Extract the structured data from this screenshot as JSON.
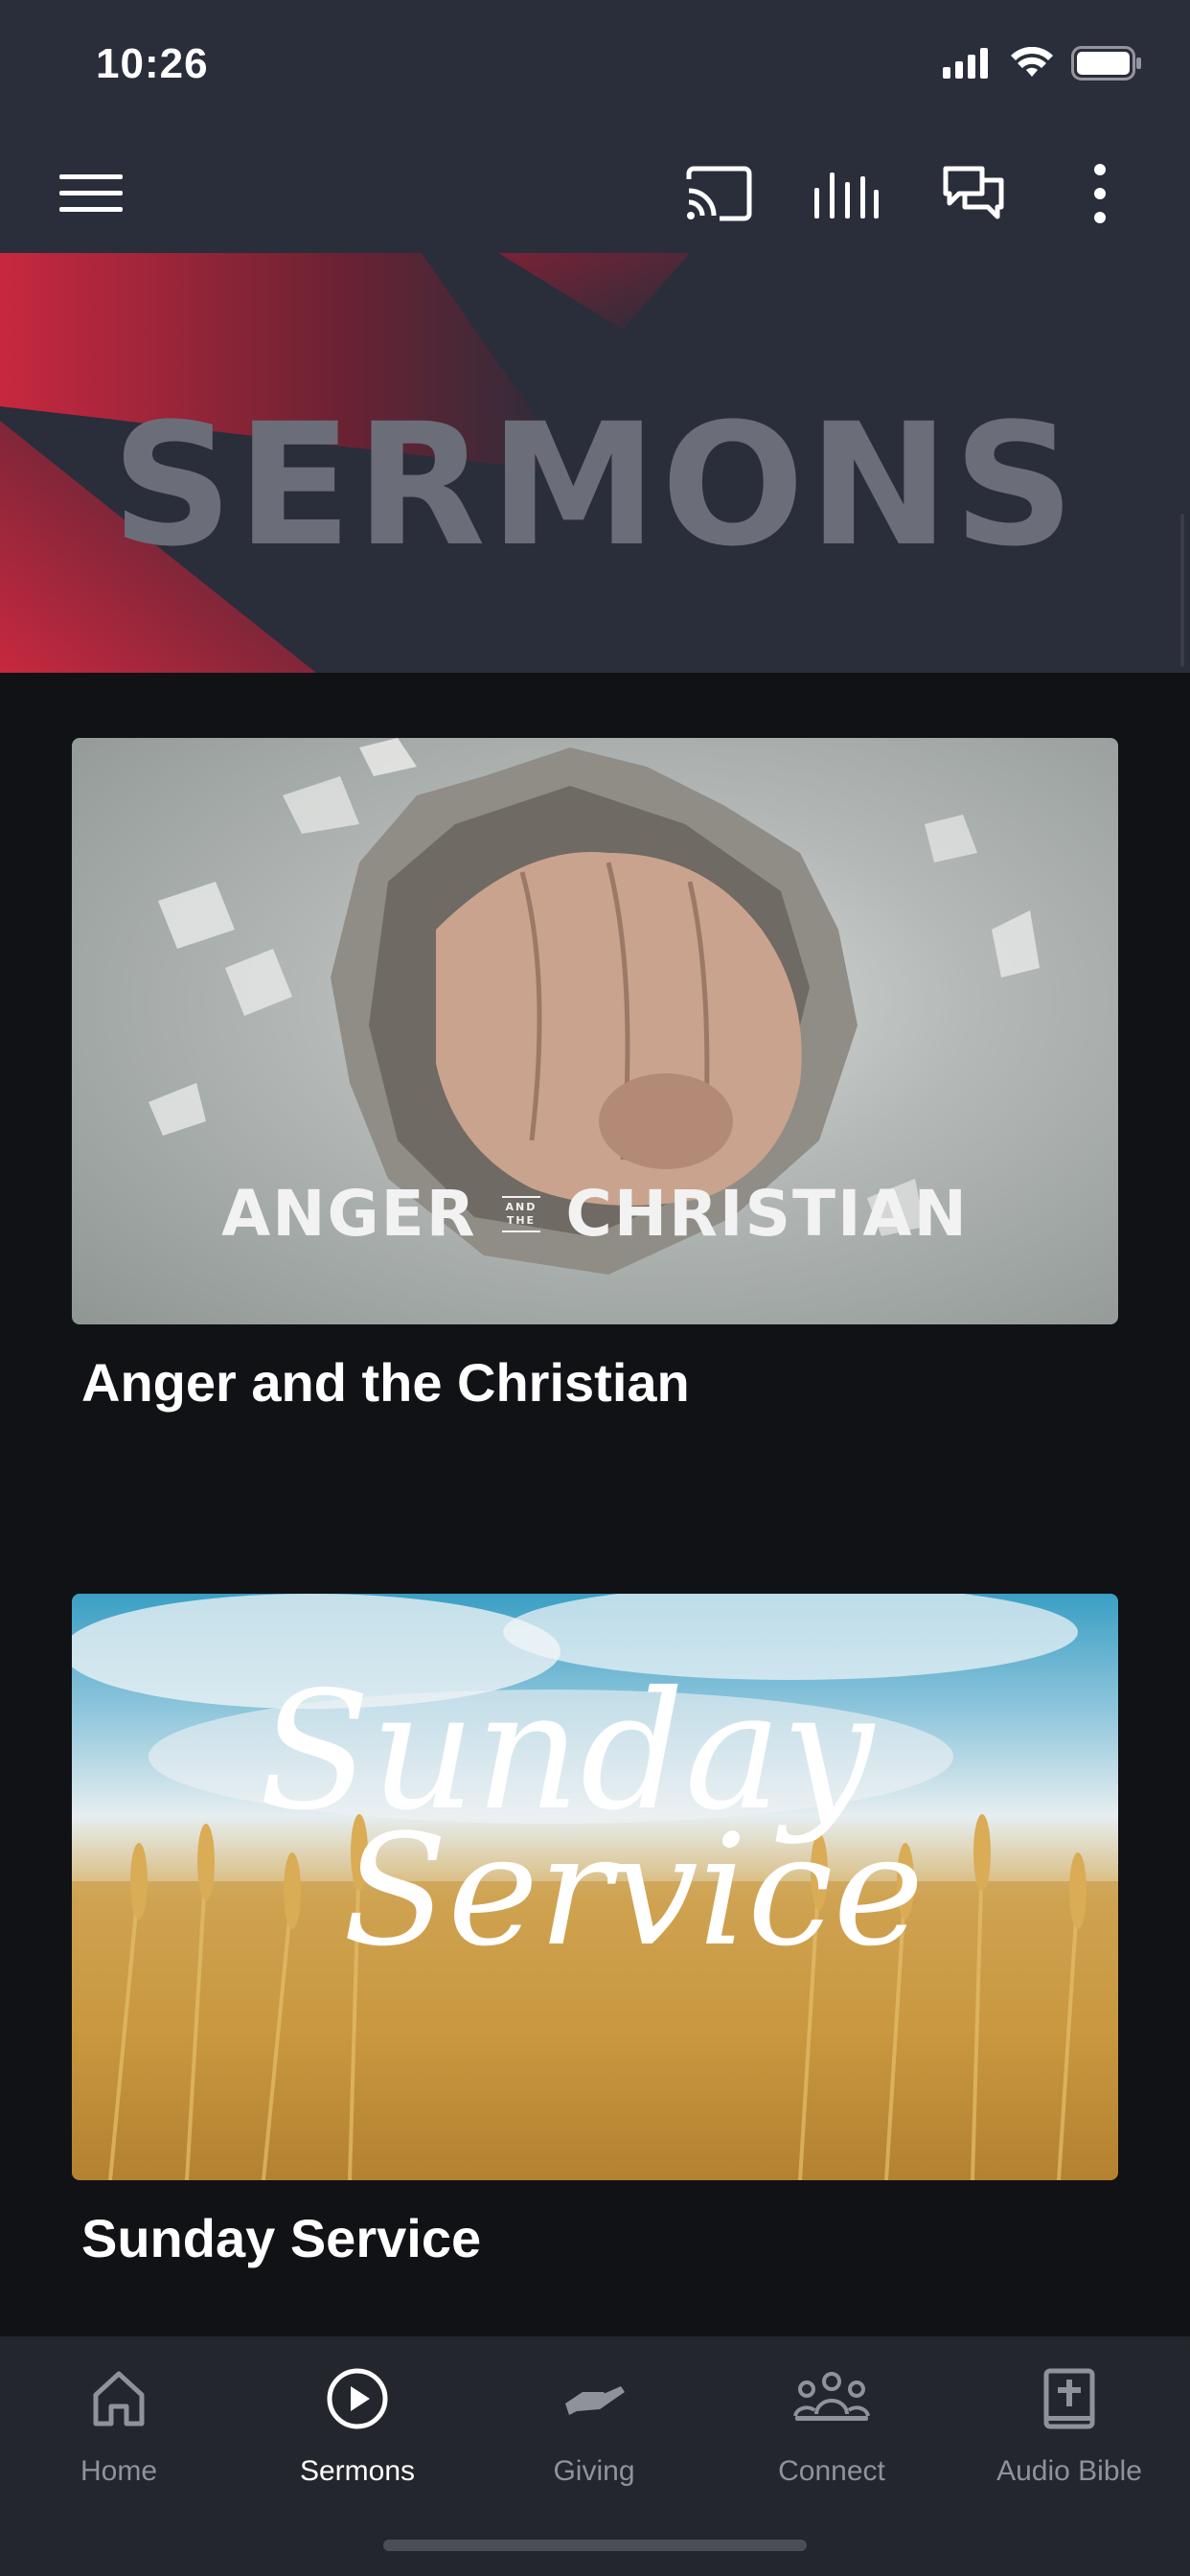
{
  "status_bar": {
    "time": "10:26"
  },
  "top_bar": {
    "menu_icon": "hamburger-menu-icon",
    "cast_icon": "cast-icon",
    "audio_icon": "audio-bars-icon",
    "chat_icon": "chat-bubbles-icon",
    "more_icon": "more-vertical-icon"
  },
  "hero": {
    "title": "SERMONS"
  },
  "sermons": [
    {
      "title": "Anger and the Christian",
      "art_text_left": "ANGER",
      "art_text_mid_top": "AND",
      "art_text_mid_bottom": "THE",
      "art_text_right": "CHRISTIAN"
    },
    {
      "title": "Sunday Service",
      "art_text_top": "Sunday",
      "art_text_bottom": "Service"
    }
  ],
  "tab_bar": {
    "tabs": [
      {
        "label": "Home",
        "icon": "home-icon",
        "active": false
      },
      {
        "label": "Sermons",
        "icon": "play-circle-icon",
        "active": true
      },
      {
        "label": "Giving",
        "icon": "giving-hand-icon",
        "active": false
      },
      {
        "label": "Connect",
        "icon": "group-icon",
        "active": false
      },
      {
        "label": "Audio Bible",
        "icon": "bible-icon",
        "active": false
      }
    ]
  },
  "colors": {
    "accent_red": "#c8283f",
    "header_bg": "#2a2d3a",
    "page_bg": "#111216",
    "tab_bg": "#24262d"
  }
}
